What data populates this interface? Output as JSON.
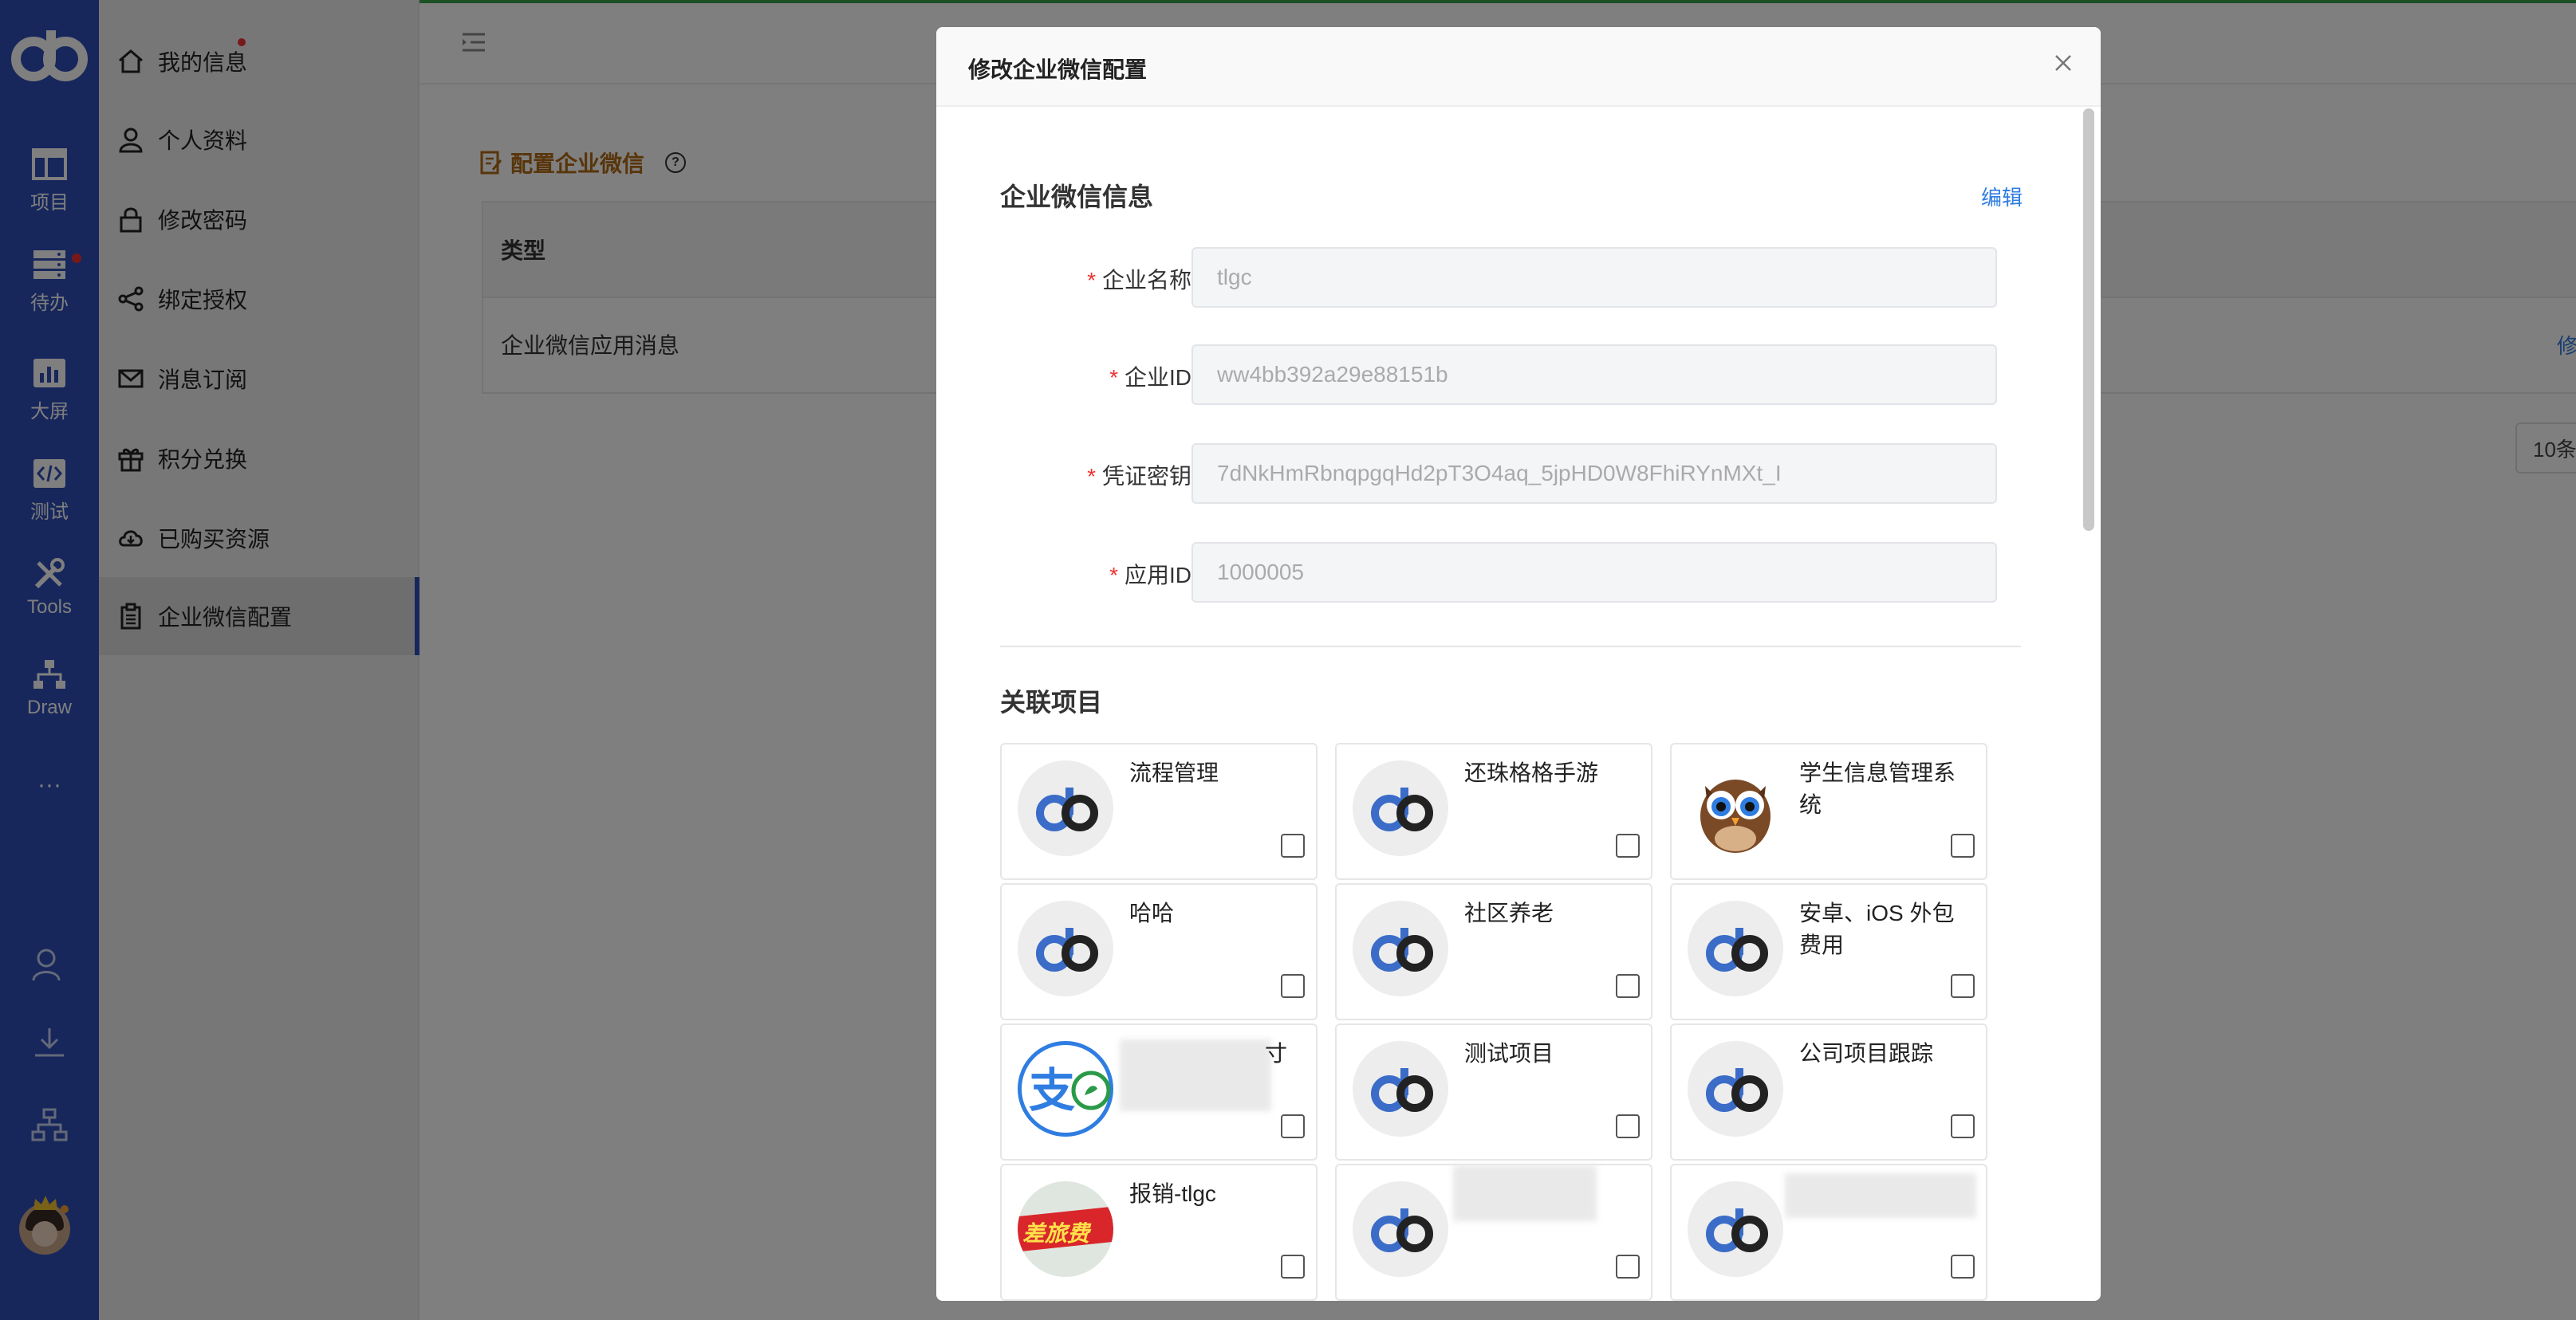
{
  "rail": {
    "items": [
      {
        "label": "项目",
        "icon": "layout-icon"
      },
      {
        "label": "待办",
        "icon": "server-icon"
      },
      {
        "label": "大屏",
        "icon": "dashboard-icon"
      },
      {
        "label": "测试",
        "icon": "code-icon"
      },
      {
        "label": "Tools",
        "icon": "tools-icon"
      },
      {
        "label": "Draw",
        "icon": "sitemap-icon"
      }
    ],
    "more": "···"
  },
  "sidebar": {
    "items": [
      {
        "label": "我的信息",
        "icon": "home-icon"
      },
      {
        "label": "个人资料",
        "icon": "user-icon"
      },
      {
        "label": "修改密码",
        "icon": "lock-icon"
      },
      {
        "label": "绑定授权",
        "icon": "share-icon"
      },
      {
        "label": "消息订阅",
        "icon": "mail-icon"
      },
      {
        "label": "积分兑换",
        "icon": "gift-icon"
      },
      {
        "label": "已购买资源",
        "icon": "cloud-icon"
      },
      {
        "label": "企业微信配置",
        "icon": "clipboard-icon"
      }
    ],
    "active_index": 7
  },
  "main": {
    "title": "配置企业微信",
    "table": {
      "header": "类型",
      "row": "企业微信应用消息",
      "row_action": "修"
    },
    "pager": "10条"
  },
  "modal": {
    "title": "修改企业微信配置",
    "info_title": "企业微信信息",
    "edit_label": "编辑",
    "fields": [
      {
        "label": "企业名称",
        "value": "tlgc"
      },
      {
        "label": "企业ID",
        "value": "ww4bb392a29e88151b"
      },
      {
        "label": "凭证密钥",
        "value": "7dNkHmRbnqpgqHd2pT3O4aq_5jpHD0W8FhiRYnMXt_I"
      },
      {
        "label": "应用ID",
        "value": "1000005"
      }
    ],
    "projects_title": "关联项目",
    "projects": [
      {
        "name": "流程管理",
        "avatar": "db-logo"
      },
      {
        "name": "还珠格格手游",
        "avatar": "db-logo"
      },
      {
        "name": "学生信息管理系统",
        "avatar": "owl-image"
      },
      {
        "name": "哈哈",
        "avatar": "db-logo"
      },
      {
        "name": "社区养老",
        "avatar": "db-logo"
      },
      {
        "name": "安卓、iOS 外包费用",
        "avatar": "db-logo"
      },
      {
        "name": "寸",
        "avatar": "alipay-logo"
      },
      {
        "name": "测试项目",
        "avatar": "db-logo"
      },
      {
        "name": "公司项目跟踪",
        "avatar": "db-logo"
      },
      {
        "name": "报销-tlgc",
        "avatar": "travel-expense-image"
      },
      {
        "name": "",
        "avatar": "db-logo"
      },
      {
        "name": "",
        "avatar": "db-logo"
      }
    ],
    "travel_badge": "差旅费"
  },
  "colors": {
    "rail": "#2f4fb8",
    "accent": "#2f7de1",
    "required": "#e33333",
    "title_orange": "#b06a14"
  }
}
